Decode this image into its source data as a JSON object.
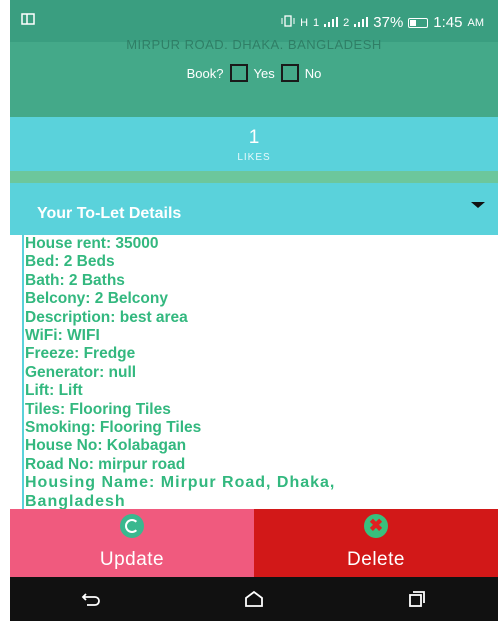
{
  "status_bar": {
    "left_icon": "screen-cast-icon",
    "signal1": "1",
    "signal2": "2",
    "battery_percent": "37%",
    "time": "1:45",
    "ampm": "AM"
  },
  "booking": {
    "address": "MIRPUR ROAD, DHAKA, BANGLADESH",
    "question": "Book?",
    "yes_label": "Yes",
    "no_label": "No"
  },
  "likes": {
    "count": "1",
    "label": "LIKES"
  },
  "details": {
    "title": "Your To-Let Details",
    "lines": [
      "House rent: 35000",
      "Bed: 2 Beds",
      "Bath: 2 Baths",
      "Belcony: 2 Belcony",
      "Description: best area",
      "WiFi: WIFI",
      "Freeze: Fredge",
      "Generator: null",
      "Lift: Lift",
      "Tiles: Flooring Tiles",
      "Smoking: Flooring Tiles",
      "House No: Kolabagan",
      "Road No: mirpur road",
      "Housing Name: Mirpur Road, Dhaka,",
      "Bangladesh"
    ]
  },
  "actions": {
    "update_label": "Update",
    "delete_label": "Delete",
    "update_icon": "refresh-icon",
    "delete_icon": "close-icon"
  },
  "colors": {
    "status_bar": "#3a9e80",
    "book_panel": "#44a989",
    "likes_panel": "#5ad2db",
    "text_green": "#33b87f",
    "update_btn": "#f05a7e",
    "delete_btn": "#d21818"
  }
}
